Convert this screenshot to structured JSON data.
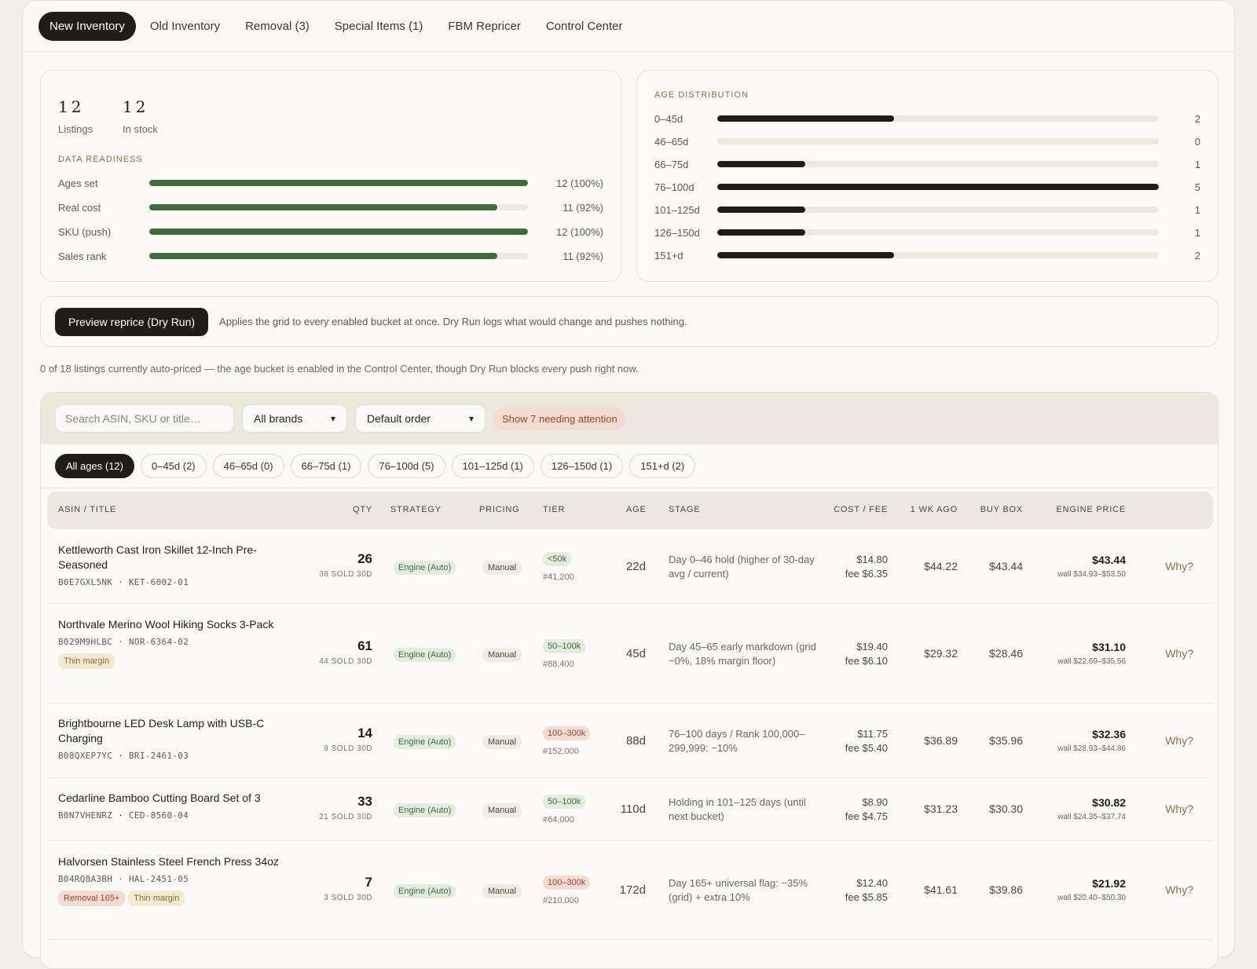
{
  "tabs": [
    {
      "label": "New Inventory",
      "active": true
    },
    {
      "label": "Old Inventory",
      "active": false
    },
    {
      "label": "Removal (3)",
      "active": false
    },
    {
      "label": "Special Items (1)",
      "active": false
    },
    {
      "label": "FBM Repricer",
      "active": false
    },
    {
      "label": "Control Center",
      "active": false
    }
  ],
  "summary": {
    "listings": {
      "value": "12",
      "label": "Listings"
    },
    "in_stock": {
      "value": "12",
      "label": "In stock"
    },
    "readiness_title": "DATA READINESS",
    "readiness": [
      {
        "label": "Ages set",
        "value": "12 (100%)",
        "fraction": 1.0
      },
      {
        "label": "Real cost",
        "value": "11 (92%)",
        "fraction": 0.92
      },
      {
        "label": "SKU (push)",
        "value": "12 (100%)",
        "fraction": 1.0
      },
      {
        "label": "Sales rank",
        "value": "11 (92%)",
        "fraction": 0.92
      }
    ]
  },
  "age_distribution": {
    "title": "AGE DISTRIBUTION",
    "max": 5,
    "buckets": [
      {
        "label": "0–45d",
        "count": "2"
      },
      {
        "label": "46–65d",
        "count": "0"
      },
      {
        "label": "66–75d",
        "count": "1"
      },
      {
        "label": "76–100d",
        "count": "5"
      },
      {
        "label": "101–125d",
        "count": "1"
      },
      {
        "label": "126–150d",
        "count": "1"
      },
      {
        "label": "151+d",
        "count": "2"
      }
    ]
  },
  "reprice": {
    "button": "Preview reprice (Dry Run)",
    "description": "Applies the grid to every enabled bucket at once. Dry Run logs what would change and pushes nothing."
  },
  "auto_note": "0 of 18 listings currently auto-priced — the age bucket is enabled in the Control Center, though Dry Run blocks every push right now.",
  "filters": {
    "search_placeholder": "Search ASIN, SKU or title…",
    "brand": "All brands",
    "order": "Default order",
    "attention": "Show 7 needing attention"
  },
  "age_chips": [
    {
      "label": "All ages (12)",
      "active": true
    },
    {
      "label": "0–45d (2)",
      "active": false
    },
    {
      "label": "46–65d (0)",
      "active": false
    },
    {
      "label": "66–75d (1)",
      "active": false
    },
    {
      "label": "76–100d (5)",
      "active": false
    },
    {
      "label": "101–125d (1)",
      "active": false
    },
    {
      "label": "126–150d (1)",
      "active": false
    },
    {
      "label": "151+d (2)",
      "active": false
    }
  ],
  "table": {
    "headers": {
      "asin": "ASIN / TITLE",
      "qty": "QTY",
      "strategy": "STRATEGY",
      "pricing": "PRICING",
      "tier": "TIER",
      "age": "AGE",
      "stage": "STAGE",
      "cost": "COST / FEE",
      "wk": "1 WK AGO",
      "buybox": "BUY BOX",
      "engine": "ENGINE PRICE"
    },
    "rows": [
      {
        "title": "Kettleworth Cast Iron Skillet 12-Inch Pre-Seasoned",
        "sku": "B0E7GXL5NK · KET-6002-01",
        "qty": "26",
        "sold": "38 SOLD 30D",
        "strategy": "Engine (Auto)",
        "pricing": "Manual",
        "tier": "<50k",
        "tier_color": "green",
        "rank": "#41,200",
        "age": "22d",
        "stage": "Day 0–46 hold (higher of 30-day avg / current)",
        "cost": "$14.80",
        "fee": "fee $6.35",
        "wk": "$44.22",
        "buybox": "$43.44",
        "engine": "$43.44",
        "wall": "wall $34.93–$53.50",
        "why": "Why?",
        "tags": []
      },
      {
        "title": "Northvale Merino Wool Hiking Socks 3-Pack",
        "sku": "B029M9HLBC · NOR-6364-02",
        "qty": "61",
        "sold": "44 SOLD 30D",
        "strategy": "Engine (Auto)",
        "pricing": "Manual",
        "tier": "50–100k",
        "tier_color": "green",
        "rank": "#88,400",
        "age": "45d",
        "stage": "Day 45–65 early markdown (grid −0%, 18% margin floor)",
        "cost": "$19.40",
        "fee": "fee $6.10",
        "wk": "$29.32",
        "buybox": "$28.46",
        "engine": "$31.10",
        "wall": "wall $22.69–$35.56",
        "why": "Why?",
        "tags": [
          {
            "label": "Thin margin",
            "color": "amber"
          }
        ]
      },
      {
        "title": "Brightbourne LED Desk Lamp with USB-C Charging",
        "sku": "B08QXEP7YC · BRI-2461-03",
        "qty": "14",
        "sold": "9 SOLD 30D",
        "strategy": "Engine (Auto)",
        "pricing": "Manual",
        "tier": "100–300k",
        "tier_color": "red",
        "rank": "#152,000",
        "age": "88d",
        "stage": "76–100 days / Rank 100,000–299,999: −10%",
        "cost": "$11.75",
        "fee": "fee $5.40",
        "wk": "$36.89",
        "buybox": "$35.96",
        "engine": "$32.36",
        "wall": "wall $28.93–$44.86",
        "why": "Why?",
        "tags": []
      },
      {
        "title": "Cedarline Bamboo Cutting Board Set of 3",
        "sku": "B0N7VHENRZ · CED-8560-04",
        "qty": "33",
        "sold": "21 SOLD 30D",
        "strategy": "Engine (Auto)",
        "pricing": "Manual",
        "tier": "50–100k",
        "tier_color": "green",
        "rank": "#64,000",
        "age": "110d",
        "stage": "Holding in 101–125 days (until next bucket)",
        "cost": "$8.90",
        "fee": "fee $4.75",
        "wk": "$31.23",
        "buybox": "$30.30",
        "engine": "$30.82",
        "wall": "wall $24.35–$37.74",
        "why": "Why?",
        "tags": []
      },
      {
        "title": "Halvorsen Stainless Steel French Press 34oz",
        "sku": "B04RQ8A3BH · HAL-2451-05",
        "qty": "7",
        "sold": "3 SOLD 30D",
        "strategy": "Engine (Auto)",
        "pricing": "Manual",
        "tier": "100–300k",
        "tier_color": "red",
        "rank": "#210,000",
        "age": "172d",
        "stage": "Day 165+ universal flag: −35% (grid) + extra 10%",
        "cost": "$12.40",
        "fee": "fee $5.85",
        "wk": "$41.61",
        "buybox": "$39.86",
        "engine": "$21.92",
        "wall": "wall $20.40–$50.30",
        "why": "Why?",
        "tags": [
          {
            "label": "Removal 165+",
            "color": "red"
          },
          {
            "label": "Thin margin",
            "color": "amber"
          }
        ]
      }
    ]
  },
  "colors": {
    "readiness_bar": "#3f6b3d",
    "age_bar": "#1f1d1b",
    "track": "#ece9e2",
    "accent": "#8b6f4c"
  }
}
